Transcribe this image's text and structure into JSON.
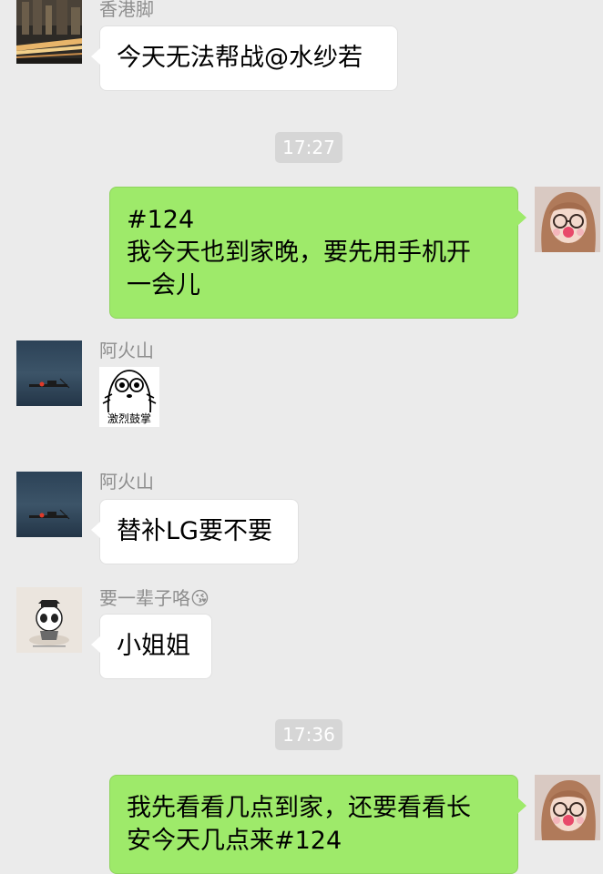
{
  "messages": {
    "m1": {
      "sender": "香港脚",
      "text": "今天无法帮战@水纱若"
    },
    "t1": {
      "time": "17:27"
    },
    "m2": {
      "text": "#124\n我今天也到家晚，要先用手机开\n一会儿"
    },
    "m3": {
      "sender": "阿火山",
      "sticker_caption": "激烈鼓掌"
    },
    "m4": {
      "sender": "阿火山",
      "text": "替补LG要不要"
    },
    "m5": {
      "sender": "要一辈子咯😘",
      "text": "小姐姐"
    },
    "t2": {
      "time": "17:36"
    },
    "m6": {
      "text": "我先看看几点到家，还要看看长\n安今天几点来#124"
    }
  },
  "avatars": {
    "hongkong": "city-night-avatar",
    "self": "girl-avatar",
    "huoshan": "lake-boat-avatar",
    "beizi": "panda-graduate-avatar"
  },
  "colors": {
    "background": "#ebebeb",
    "incoming_bubble": "#ffffff",
    "outgoing_bubble": "#9eea6a",
    "timestamp_bg": "#d6d6d6",
    "sender_name": "#8e8e8e"
  }
}
